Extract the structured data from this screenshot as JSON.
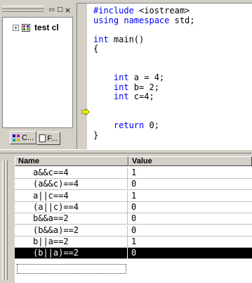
{
  "class_view": {
    "tree_item_label": "test cl",
    "expander": "+",
    "tabs": [
      {
        "label": "C..."
      },
      {
        "label": "F..."
      }
    ]
  },
  "editor": {
    "lines": [
      {
        "kw": "#include ",
        "tx": "<iostream>"
      },
      {
        "kw": "using namespace ",
        "tx": "std;"
      },
      {
        "kw": "",
        "tx": ""
      },
      {
        "kw": "int ",
        "tx": "main()"
      },
      {
        "kw": "",
        "tx": "{"
      },
      {
        "kw": "",
        "tx": ""
      },
      {
        "kw": "",
        "tx": ""
      },
      {
        "kw": "    int ",
        "tx": "a = 4;"
      },
      {
        "kw": "    int ",
        "tx": "b= 2;"
      },
      {
        "kw": "    int ",
        "tx": "c=4;"
      },
      {
        "kw": "",
        "tx": ""
      },
      {
        "kw": "",
        "tx": ""
      },
      {
        "kw": "    return ",
        "tx": "0;"
      },
      {
        "kw": "",
        "tx": "}"
      }
    ]
  },
  "watch": {
    "columns": {
      "name": "Name",
      "value": "Value"
    },
    "rows": [
      {
        "name": "a&&c==4",
        "value": "1"
      },
      {
        "name": "(a&&c)==4",
        "value": "0"
      },
      {
        "name": "a||c==4",
        "value": "1"
      },
      {
        "name": "(a||c)==4",
        "value": "0"
      },
      {
        "name": "b&&a==2",
        "value": "0"
      },
      {
        "name": "(b&&a)==2",
        "value": "0"
      },
      {
        "name": "b||a==2",
        "value": "1"
      },
      {
        "name": "(b||a)==2",
        "value": "0"
      }
    ],
    "selected_index": 7
  }
}
